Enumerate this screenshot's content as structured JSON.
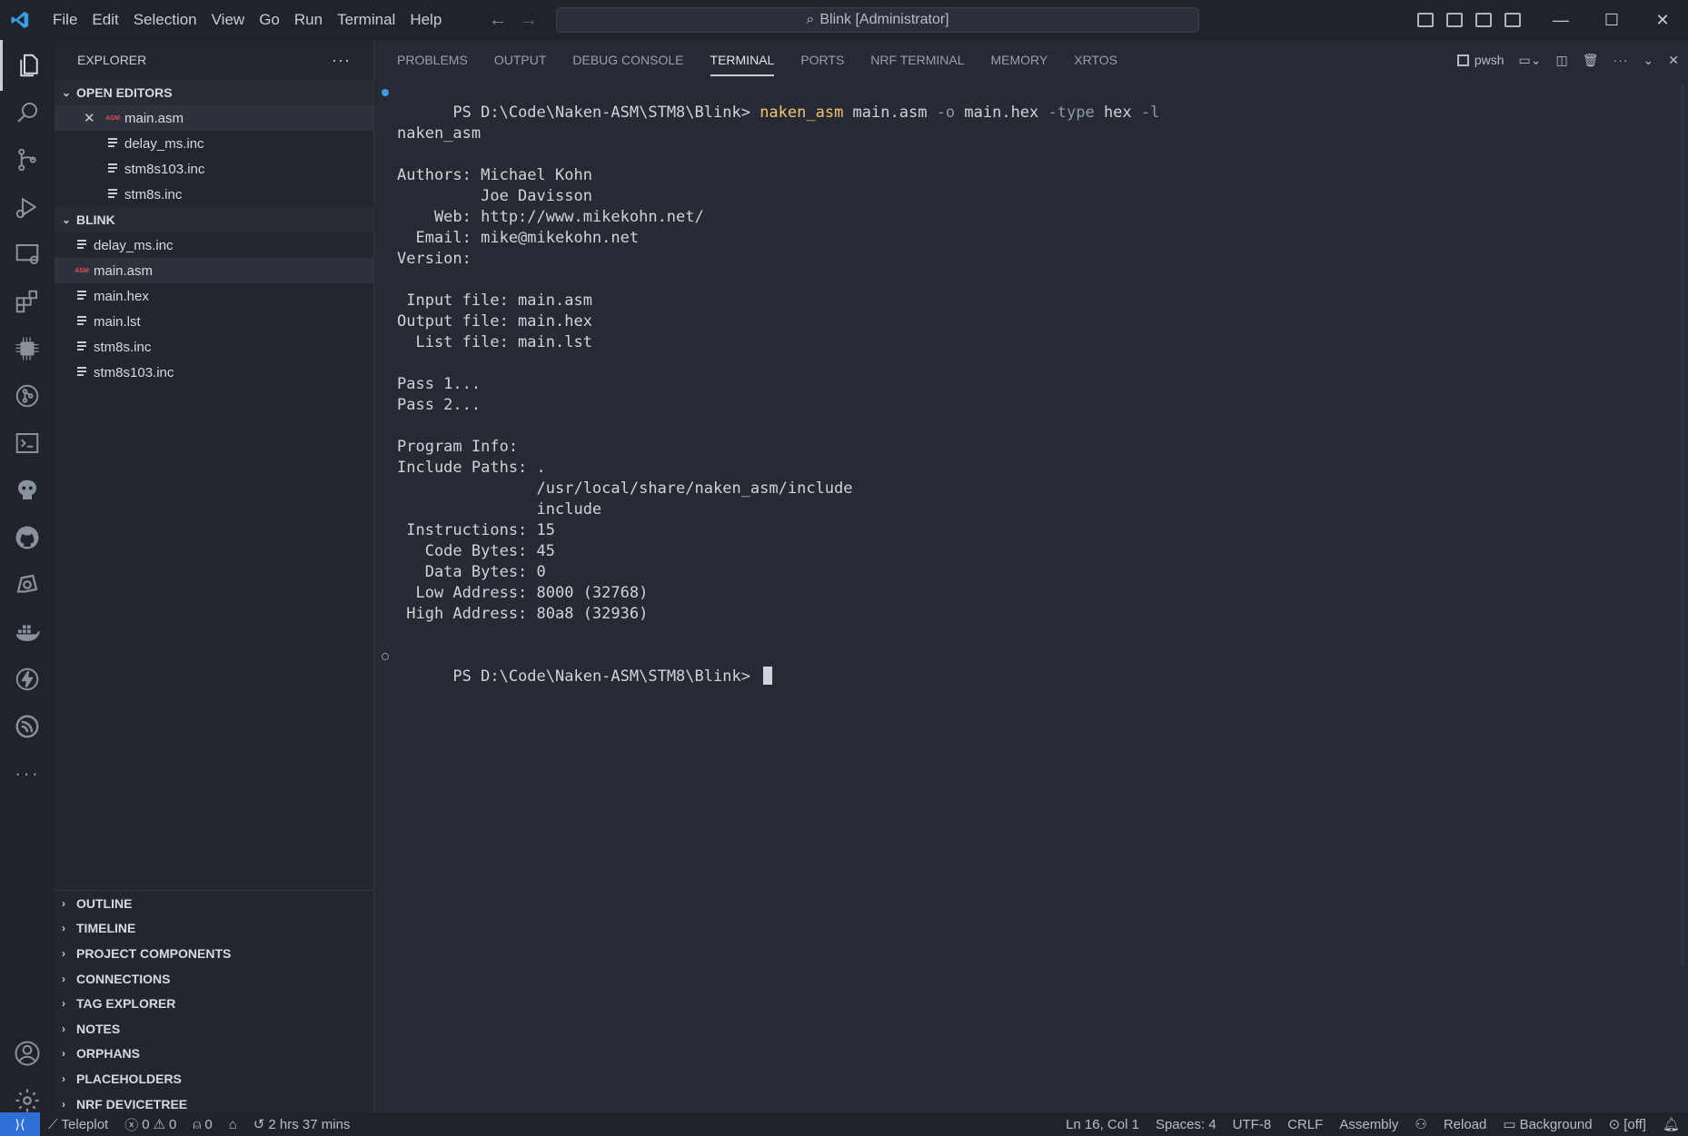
{
  "menu": [
    "File",
    "Edit",
    "Selection",
    "View",
    "Go",
    "Run",
    "Terminal",
    "Help"
  ],
  "search": {
    "text": "Blink [Administrator]"
  },
  "sidebar": {
    "title": "EXPLORER",
    "open_editors": {
      "label": "OPEN EDITORS",
      "files": [
        {
          "name": "main.asm",
          "type": "asm",
          "modified": true
        },
        {
          "name": "delay_ms.inc",
          "type": "text"
        },
        {
          "name": "stm8s103.inc",
          "type": "text"
        },
        {
          "name": "stm8s.inc",
          "type": "text"
        }
      ]
    },
    "folder": {
      "label": "BLINK",
      "files": [
        {
          "name": "delay_ms.inc",
          "type": "text"
        },
        {
          "name": "main.asm",
          "type": "asm"
        },
        {
          "name": "main.hex",
          "type": "text"
        },
        {
          "name": "main.lst",
          "type": "text"
        },
        {
          "name": "stm8s.inc",
          "type": "text"
        },
        {
          "name": "stm8s103.inc",
          "type": "text"
        }
      ]
    },
    "sections": [
      "OUTLINE",
      "TIMELINE",
      "PROJECT COMPONENTS",
      "CONNECTIONS",
      "TAG EXPLORER",
      "NOTES",
      "ORPHANS",
      "PLACEHOLDERS",
      "NRF DEVICETREE"
    ]
  },
  "panel": {
    "tabs": [
      "PROBLEMS",
      "OUTPUT",
      "DEBUG CONSOLE",
      "TERMINAL",
      "PORTS",
      "NRF TERMINAL",
      "MEMORY",
      "XRTOS"
    ],
    "active_tab": "TERMINAL",
    "shell": "pwsh"
  },
  "terminal": {
    "prompt": "PS D:\\Code\\Naken-ASM\\STM8\\Blink> ",
    "command": "naken_asm",
    "args1": " main.asm ",
    "flag1": "-o",
    "args2": " main.hex ",
    "flag2": "-type",
    "args3": " hex ",
    "flag3": "-l",
    "output": [
      "",
      "naken_asm",
      "",
      "Authors: Michael Kohn",
      "         Joe Davisson",
      "    Web: http://www.mikekohn.net/",
      "  Email: mike@mikekohn.net",
      "Version:",
      "",
      " Input file: main.asm",
      "Output file: main.hex",
      "  List file: main.lst",
      "",
      "Pass 1...",
      "Pass 2...",
      "",
      "Program Info:",
      "Include Paths: .",
      "               /usr/local/share/naken_asm/include",
      "               include",
      " Instructions: 15",
      "   Code Bytes: 45",
      "   Data Bytes: 0",
      "  Low Address: 8000 (32768)",
      " High Address: 80a8 (32936)",
      ""
    ],
    "final_prompt": "PS D:\\Code\\Naken-ASM\\STM8\\Blink> "
  },
  "statusbar": {
    "teleplot": "Teleplot",
    "errors": "0",
    "warnings": "0",
    "ports": "0",
    "timer": "2 hrs 37 mins",
    "position": "Ln 16, Col 1",
    "spaces": "Spaces: 4",
    "encoding": "UTF-8",
    "eol": "CRLF",
    "language": "Assembly",
    "reload": "Reload",
    "background": "Background",
    "off": "[off]"
  },
  "colors": {
    "accent": "#2f6fd6",
    "command": "#f6c370",
    "asm_icon": "#e05252",
    "dot_active": "#3b9ee0"
  }
}
